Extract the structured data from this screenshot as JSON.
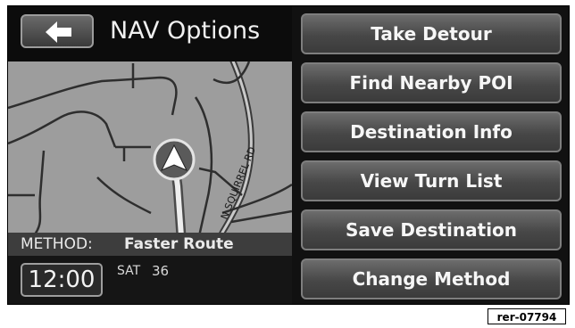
{
  "header": {
    "back_icon": "left-arrow-icon",
    "title": "NAV Options"
  },
  "map": {
    "street_label": "N SQUIRREL RD",
    "vehicle_icon": "navigation-arrow-icon"
  },
  "method": {
    "label": "METHOD:",
    "value": "Faster Route"
  },
  "status": {
    "time": "12:00",
    "day": "SAT",
    "temperature": "36"
  },
  "options": [
    {
      "label": "Take Detour"
    },
    {
      "label": "Find Nearby POI"
    },
    {
      "label": "Destination Info"
    },
    {
      "label": "View Turn List"
    },
    {
      "label": "Save Destination"
    },
    {
      "label": "Change Method"
    }
  ],
  "reference_code": "rer-07794"
}
